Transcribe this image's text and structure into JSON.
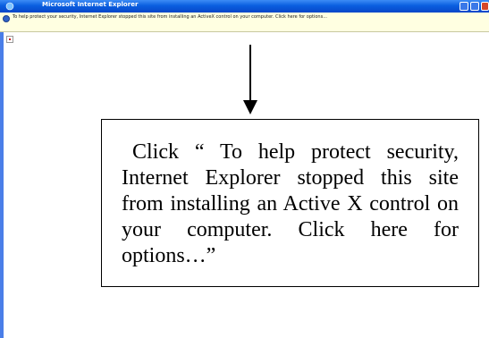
{
  "window": {
    "title": "Microsoft Internet Explorer",
    "colors": {
      "titlebar": "#0a5fe0",
      "infobar": "#ffffe1",
      "close_button": "#d6472a"
    }
  },
  "infobar": {
    "icon": "shield-icon",
    "message": "To help protect your security, Internet Explorer stopped this site from installing an ActiveX control on your computer. Click here for options..."
  },
  "page": {
    "placeholder_icon": "broken-activex-icon"
  },
  "annotation": {
    "text": "Click “ To help protect security, Internet Explorer stopped this site from installing an Active X control on your computer. Click here for options…”"
  }
}
